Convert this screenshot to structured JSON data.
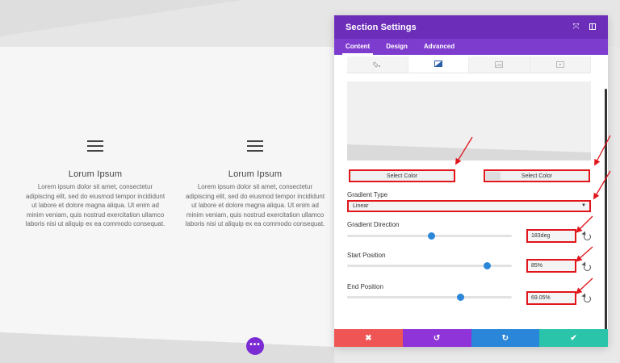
{
  "page": {
    "columns": [
      {
        "title": "Lorum Ipsum",
        "body": "Lorem ipsum dolor sit amet, consectetur adipiscing elit, sed do eiusmod tempor incididunt ut labore et dolore magna aliqua. Ut enim ad minim veniam, quis nostrud exercitation ullamco laboris nisi ut aliquip ex ea commodo consequat.",
        "icon": "hamburger-menu-icon"
      },
      {
        "title": "Lorum Ipsum",
        "body": "Lorem ipsum dolor sit amet, consectetur adipiscing elit, sed do eiusmod tempor incididunt ut labore et dolore magna aliqua. Ut enim ad minim veniam, quis nostrud exercitation ullamco laboris nisi ut aliquip ex ea commodo consequat.",
        "icon": "hamburger-menu-icon"
      }
    ],
    "fab_label": "•••"
  },
  "modal": {
    "title": "Section Settings",
    "tabs": [
      {
        "label": "Content",
        "active": true
      },
      {
        "label": "Design",
        "active": false
      },
      {
        "label": "Advanced",
        "active": false
      }
    ],
    "background_tabs": [
      {
        "icon": "paint-bucket-icon",
        "active": false
      },
      {
        "icon": "gradient-icon",
        "active": true
      },
      {
        "icon": "image-icon",
        "active": false
      },
      {
        "icon": "video-icon",
        "active": false
      }
    ],
    "color_pickers": [
      {
        "label": "Select Color"
      },
      {
        "label": "Select Color"
      }
    ],
    "gradient_type": {
      "label": "Gradient Type",
      "value": "Linear"
    },
    "gradient_direction": {
      "label": "Gradient Direction",
      "value": "183deg",
      "slider_fraction": 0.51
    },
    "start_position": {
      "label": "Start Position",
      "value": "85%",
      "slider_fraction": 0.85
    },
    "end_position": {
      "label": "End Position",
      "value": "69.05%",
      "slider_fraction": 0.69
    },
    "footer": {
      "cancel": "✖",
      "undo": "↺",
      "redo": "↻",
      "save": "✔"
    }
  },
  "colors": {
    "header_purple": "#6c2eb9",
    "tab_purple": "#7e3ccf",
    "highlight_red": "#e0161c",
    "slider_blue": "#2a86d9",
    "cancel_red": "#ef5555",
    "undo_purple": "#8e34d8",
    "redo_blue": "#2a86d9",
    "save_green": "#29c4a9"
  }
}
